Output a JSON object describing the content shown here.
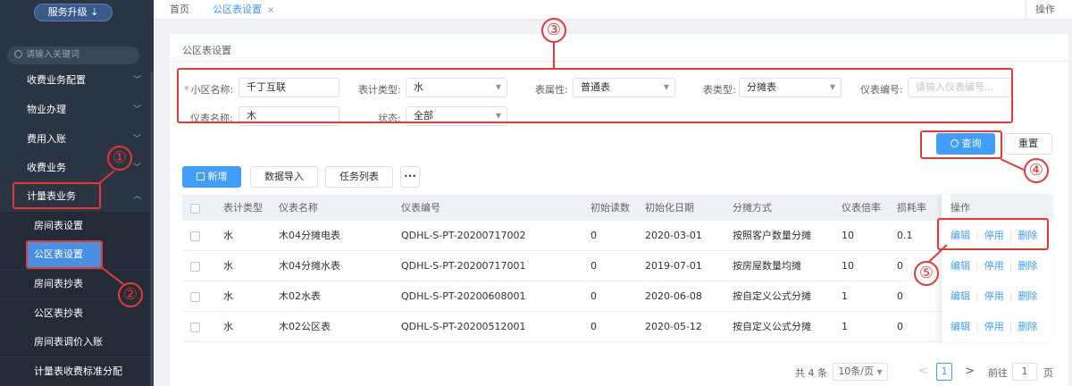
{
  "sidebar": {
    "upgrade": "服务升级 ⇣",
    "search_placeholder": "请输入关键词",
    "menu": [
      {
        "label": "收费业务配置"
      },
      {
        "label": "物业办理"
      },
      {
        "label": "费用入账"
      },
      {
        "label": "收费业务"
      },
      {
        "label": "计量表业务"
      }
    ],
    "sub": [
      {
        "label": "房间表设置"
      },
      {
        "label": "公区表设置"
      },
      {
        "label": "房间表抄表"
      },
      {
        "label": "公区表抄表"
      },
      {
        "label": "房间表调价入账"
      },
      {
        "label": "计量表收费标准分配"
      }
    ]
  },
  "topbar": {
    "home": "首页",
    "active_tab": "公区表设置",
    "close": "×",
    "ops": "操作"
  },
  "panel": {
    "title": "公区表设置"
  },
  "form": {
    "community_label": "小区名称:",
    "community_value": "千丁互联",
    "meter_type_label": "表计类型:",
    "meter_type_value": "水",
    "attr_label": "表属性:",
    "attr_value": "普通表",
    "kind_label": "表类型:",
    "kind_value": "分摊表",
    "code_label": "仪表编号:",
    "code_placeholder": "请输入仪表编号...",
    "name_label": "仪表名称:",
    "name_value": "木",
    "status_label": "状态:",
    "status_value": "全部"
  },
  "buttons": {
    "query": "查询",
    "reset": "重置",
    "add": "新增",
    "import": "数据导入",
    "tasks": "任务列表",
    "more": "•••"
  },
  "table": {
    "headers": [
      "表计类型",
      "仪表名称",
      "仪表编号",
      "初始读数",
      "初始化日期",
      "分摊方式",
      "仪表倍率",
      "损耗率",
      "操作"
    ],
    "rows": [
      {
        "type": "水",
        "name": "木04分摊电表",
        "code": "QDHL-S-PT-20200717002",
        "init": "0",
        "date": "2020-03-01",
        "method": "按照客户数量分摊",
        "rate": "10",
        "loss": "0.1"
      },
      {
        "type": "水",
        "name": "木04分摊水表",
        "code": "QDHL-S-PT-20200717001",
        "init": "0",
        "date": "2019-07-01",
        "method": "按房屋数量均摊",
        "rate": "10",
        "loss": "0"
      },
      {
        "type": "水",
        "name": "木02水表",
        "code": "QDHL-S-PT-20200608001",
        "init": "0",
        "date": "2020-06-08",
        "method": "按自定义公式分摊",
        "rate": "1",
        "loss": "0"
      },
      {
        "type": "水",
        "name": "木02公区表",
        "code": "QDHL-S-PT-20200512001",
        "init": "0",
        "date": "2020-05-12",
        "method": "按自定义公式分摊",
        "rate": "1",
        "loss": "0"
      }
    ],
    "actions": {
      "edit": "编辑",
      "disable": "停用",
      "delete": "删除",
      "sep": "|"
    }
  },
  "pagination": {
    "total": "共 4 条",
    "page_size": "10条/页",
    "prev": "<",
    "current": "1",
    "next": ">",
    "goto": "前往",
    "goto_value": "1",
    "page_unit": "页"
  },
  "annotations": [
    "①",
    "②",
    "③",
    "④",
    "⑤"
  ],
  "colors": {
    "accent": "#409eff",
    "annotation": "#e53935",
    "sidebar": "#2b3442"
  }
}
